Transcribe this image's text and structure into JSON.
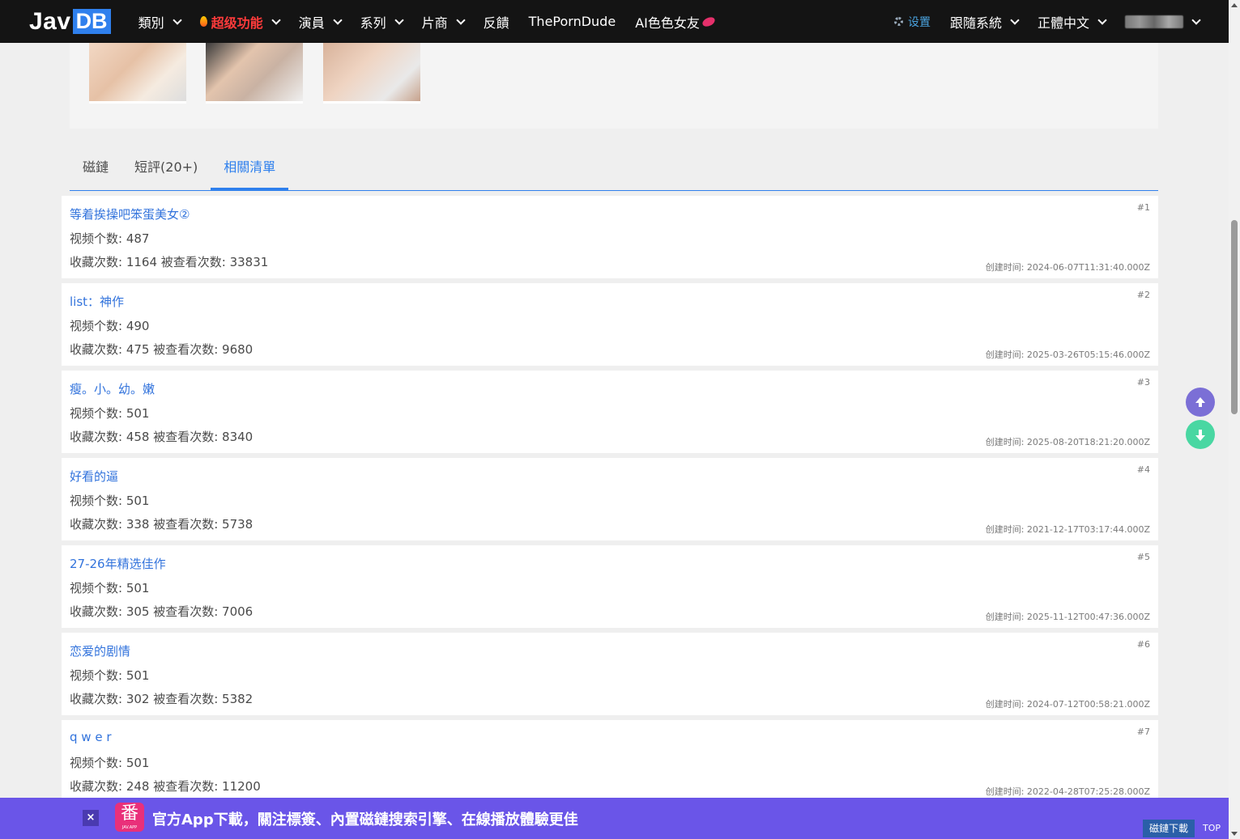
{
  "nav": {
    "logo_jav": "Jav",
    "logo_db": "DB",
    "items": [
      {
        "label": "類別",
        "has_dropdown": true
      },
      {
        "label": "超级功能",
        "has_dropdown": true,
        "hot": true
      },
      {
        "label": "演員",
        "has_dropdown": true
      },
      {
        "label": "系列",
        "has_dropdown": true
      },
      {
        "label": "片商",
        "has_dropdown": true
      },
      {
        "label": "反饋",
        "has_dropdown": false
      },
      {
        "label": "ThePornDude",
        "has_dropdown": false
      },
      {
        "label": "AI色色女友",
        "has_dropdown": false
      }
    ],
    "settings_label": "设置",
    "follow_system_label": "跟隨系統",
    "language_label": "正體中文"
  },
  "tabs": [
    {
      "label": "磁鏈",
      "active": false
    },
    {
      "label": "短評(20+)",
      "active": false
    },
    {
      "label": "相關清單",
      "active": true
    }
  ],
  "lists": [
    {
      "rank": "#1",
      "title": "等着挨操吧笨蛋美女②",
      "video_count": "视频个数: 487",
      "stats": "收藏次数: 1164 被查看次数: 33831",
      "created": "创建时间: 2024-06-07T11:31:40.000Z"
    },
    {
      "rank": "#2",
      "title": "list：神作",
      "video_count": "视频个数: 490",
      "stats": "收藏次数: 475 被查看次数: 9680",
      "created": "创建时间: 2025-03-26T05:15:46.000Z"
    },
    {
      "rank": "#3",
      "title": "瘦。小。幼。嫩",
      "video_count": "视频个数: 501",
      "stats": "收藏次数: 458 被查看次数: 8340",
      "created": "创建时间: 2025-08-20T18:21:20.000Z"
    },
    {
      "rank": "#4",
      "title": "好看的逼",
      "video_count": "视频个数: 501",
      "stats": "收藏次数: 338 被查看次数: 5738",
      "created": "创建时间: 2021-12-17T03:17:44.000Z"
    },
    {
      "rank": "#5",
      "title": "27-26年精选佳作",
      "video_count": "视频个数: 501",
      "stats": "收藏次数: 305 被查看次数: 7006",
      "created": "创建时间: 2025-11-12T00:47:36.000Z"
    },
    {
      "rank": "#6",
      "title": "恋爱的剧情",
      "video_count": "视频个数: 501",
      "stats": "收藏次数: 302 被查看次数: 5382",
      "created": "创建时间: 2024-07-12T00:58:21.000Z"
    },
    {
      "rank": "#7",
      "title": "q w e r",
      "video_count": "视频个数: 501",
      "stats": "收藏次数: 248 被查看次数: 11200",
      "created": "创建时间: 2022-04-28T07:25:28.000Z"
    }
  ],
  "banner": {
    "close": "×",
    "app_icon_char": "番",
    "app_icon_sub": "JAV.APP",
    "text": "官方App下載，關注標簽、內置磁鏈搜索引擎、在線播放體驗更佳",
    "magnet_download": "磁鏈下載",
    "top": "TOP"
  },
  "colors": {
    "navbar_bg": "#141414",
    "accent": "#2f80ed",
    "hot": "#ff3b3b",
    "banner_bg": "#6a55e8",
    "fab_up": "#7b6fd6",
    "fab_down": "#49d7a2"
  }
}
